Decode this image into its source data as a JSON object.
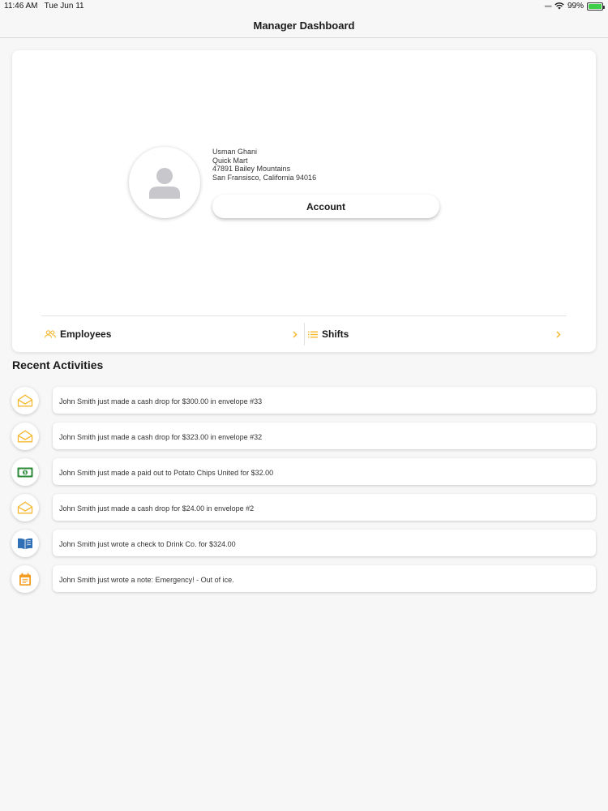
{
  "status_bar": {
    "time": "11:46 AM",
    "date": "Tue Jun 11",
    "battery": "99%",
    "battery_level": 0.99
  },
  "nav": {
    "title": "Manager Dashboard"
  },
  "profile": {
    "name": "Usman Ghani",
    "store": "Quick Mart",
    "street": "47891 Bailey Mountains",
    "city": "San Fransisco, California 94016",
    "account_label": "Account"
  },
  "links": {
    "employees": "Employees",
    "shifts": "Shifts"
  },
  "recent": {
    "title": "Recent Activities",
    "items": [
      {
        "icon": "envelope-icon",
        "text": "John Smith just made a cash drop for $300.00 in envelope #33"
      },
      {
        "icon": "envelope-icon",
        "text": "John Smith just made a cash drop for $323.00 in envelope #32"
      },
      {
        "icon": "cash-icon",
        "text": "John Smith just made a paid out to Potato Chips United for $32.00"
      },
      {
        "icon": "envelope-icon",
        "text": "John Smith just made a cash drop for $24.00 in envelope #2"
      },
      {
        "icon": "book-icon",
        "text": "John Smith just wrote a check to Drink Co. for $324.00"
      },
      {
        "icon": "note-icon",
        "text": "John Smith just wrote a note: Emergency! - Out of ice."
      }
    ]
  },
  "colors": {
    "accent": "#f5b82e",
    "cash_green": "#2e8b3a",
    "book_blue": "#2f6fb5",
    "note_orange": "#f39c1f",
    "battery_green": "#3ecf4a"
  }
}
